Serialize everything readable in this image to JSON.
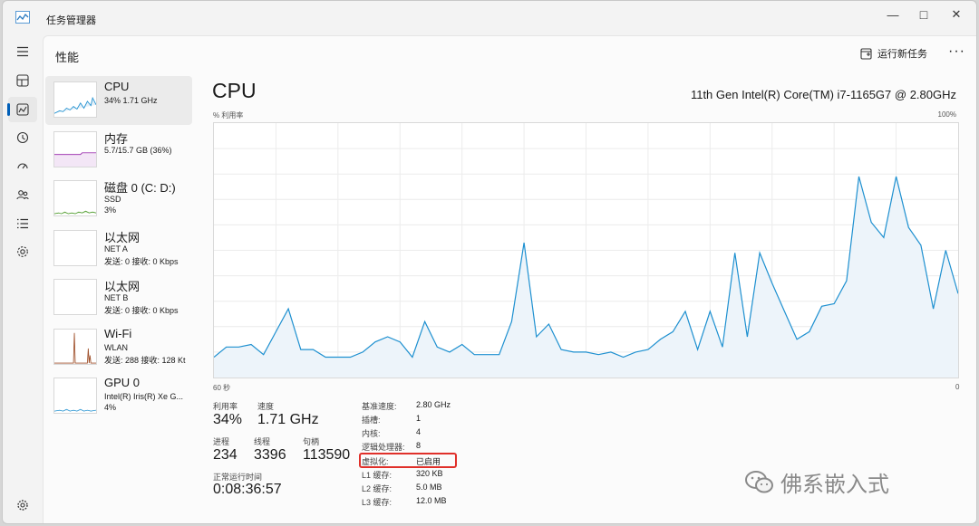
{
  "window": {
    "title": "任务管理器",
    "controls": {
      "minimize": "—",
      "maximize": "□",
      "close": "✕"
    }
  },
  "nav": [
    {
      "icon": "hamburger-menu-icon",
      "glyph": "☰"
    },
    {
      "icon": "processes-icon",
      "glyph": "⧉"
    },
    {
      "icon": "performance-icon",
      "glyph": "📈",
      "active": true
    },
    {
      "icon": "app-history-icon",
      "glyph": "⟲"
    },
    {
      "icon": "startup-apps-icon",
      "glyph": "⚡"
    },
    {
      "icon": "users-icon",
      "glyph": "👥"
    },
    {
      "icon": "details-icon",
      "glyph": "☰"
    },
    {
      "icon": "services-icon",
      "glyph": "⚙"
    },
    {
      "icon": "settings-icon",
      "glyph": "⚙"
    }
  ],
  "header": {
    "title": "性能",
    "run_new_task": "运行新任务",
    "more": "···"
  },
  "devices": [
    {
      "name": "CPU",
      "line1": "34%  1.71 GHz",
      "line2": "",
      "selected": true
    },
    {
      "name": "内存",
      "line1": "5.7/15.7 GB (36%)",
      "line2": ""
    },
    {
      "name": "磁盘 0 (C: D:)",
      "line1": "SSD",
      "line2": "3%"
    },
    {
      "name": "以太网",
      "line1": "NET A",
      "line2": "发送: 0 接收: 0 Kbps"
    },
    {
      "name": "以太网",
      "line1": "NET B",
      "line2": "发送: 0 接收: 0 Kbps"
    },
    {
      "name": "Wi-Fi",
      "line1": "WLAN",
      "line2": "发送: 288 接收: 128 Kt"
    },
    {
      "name": "GPU 0",
      "line1": "Intel(R) Iris(R) Xe G...",
      "line2": "4%"
    }
  ],
  "detail": {
    "title": "CPU",
    "model": "11th Gen Intel(R) Core(TM) i7-1165G7 @ 2.80GHz",
    "y_label": "% 利用率",
    "y_max": "100%",
    "x_left": "60 秒",
    "x_right": "0"
  },
  "stats": {
    "utilization_label": "利用率",
    "utilization": "34%",
    "speed_label": "速度",
    "speed": "1.71 GHz",
    "processes_label": "进程",
    "processes": "234",
    "threads_label": "线程",
    "threads": "3396",
    "handles_label": "句柄",
    "handles": "113590",
    "uptime_label": "正常运行时间",
    "uptime": "0:08:36:57"
  },
  "specs": [
    {
      "label": "基准速度:",
      "value": "2.80 GHz"
    },
    {
      "label": "插槽:",
      "value": "1"
    },
    {
      "label": "内核:",
      "value": "4"
    },
    {
      "label": "逻辑处理器:",
      "value": "8"
    },
    {
      "label": "虚拟化:",
      "value": "已启用"
    },
    {
      "label": "L1 缓存:",
      "value": "320 KB"
    },
    {
      "label": "L2 缓存:",
      "value": "5.0 MB"
    },
    {
      "label": "L3 缓存:",
      "value": "12.0 MB"
    }
  ],
  "watermark": "佛系嵌入式",
  "colors": {
    "accent": "#005fb8",
    "cpu_line": "#1e90d0",
    "cpu_fill": "#edf4fa",
    "mem_line": "#9b2fae",
    "disk_line": "#4c9a2a",
    "wifi_line": "#a0522d",
    "highlight": "#e0302a"
  },
  "chart_data": {
    "type": "area",
    "title": "CPU",
    "xlabel": "60 秒",
    "ylabel": "% 利用率",
    "ylim": [
      0,
      100
    ],
    "xlim": [
      60,
      0
    ],
    "x": [
      60,
      59,
      58,
      57,
      56,
      55,
      54,
      53,
      52,
      51,
      50,
      49,
      48,
      47,
      46,
      45,
      44,
      43,
      42,
      41,
      40,
      39,
      38,
      37,
      36,
      35,
      34,
      33,
      32,
      31,
      30,
      29,
      28,
      27,
      26,
      25,
      24,
      23,
      22,
      21,
      20,
      19,
      18,
      17,
      16,
      15,
      14,
      13,
      12,
      11,
      10,
      9,
      8,
      7,
      6,
      5,
      4,
      3,
      2,
      1,
      0
    ],
    "series": [
      {
        "values": [
          8,
          12,
          12,
          13,
          9,
          18,
          27,
          11,
          11,
          8,
          8,
          8,
          10,
          14,
          16,
          14,
          8,
          22,
          12,
          10,
          13,
          9,
          9,
          9,
          22,
          53,
          16,
          21,
          11,
          10,
          10,
          9,
          10,
          8,
          10,
          11,
          15,
          18,
          26,
          11,
          26,
          12,
          49,
          16,
          49,
          37,
          26,
          15,
          18,
          28,
          29,
          38,
          79,
          61,
          55,
          79,
          59,
          52,
          27,
          50,
          33
        ]
      }
    ]
  }
}
